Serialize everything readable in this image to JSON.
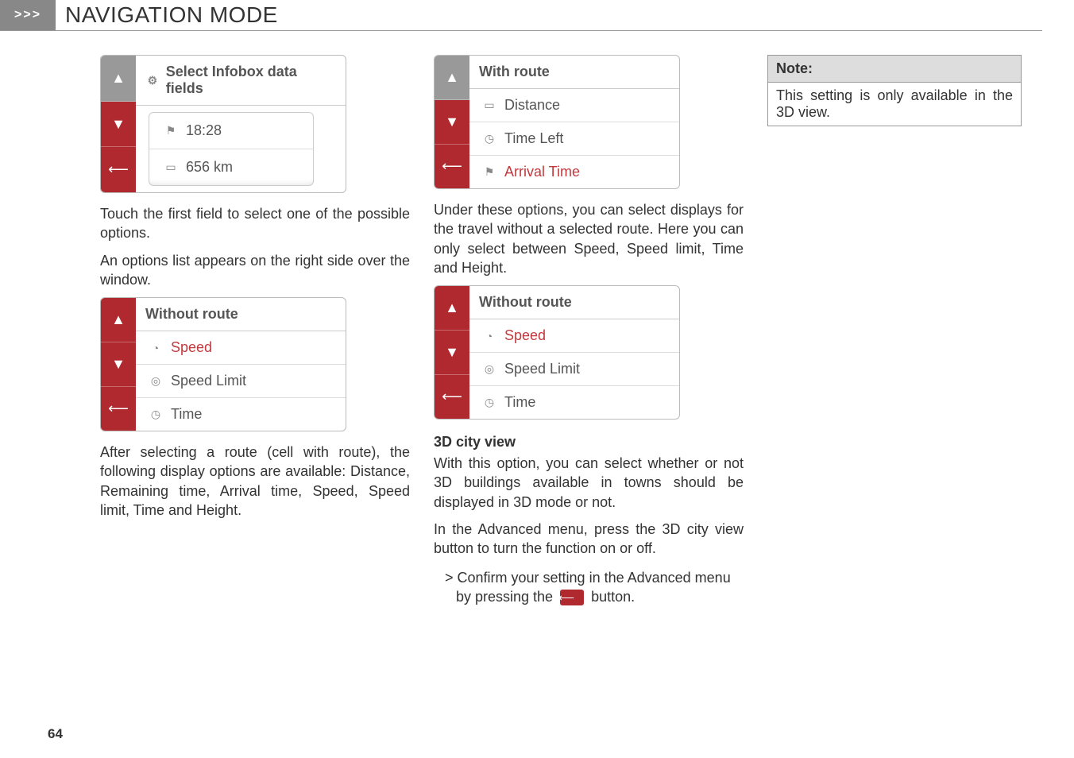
{
  "header": {
    "marker": ">>>",
    "title": "NAVIGATION MODE"
  },
  "col_left": {
    "widget1": {
      "title": "Select Infobox data fields",
      "row1": "18:28",
      "row2": "656 km"
    },
    "p1": "Touch the first field to select one of the possible options.",
    "p2": "An options list appears on the right side over the window.",
    "widget2": {
      "title": "Without route",
      "row1": "Speed",
      "row2": "Speed Limit",
      "row3": "Time"
    },
    "p3": "After selecting a route (cell with route), the following display options are available: Distance, Remaining time, Arrival time, Speed, Speed limit, Time and Height."
  },
  "col_mid": {
    "widget1": {
      "title": "With route",
      "row1": "Distance",
      "row2": "Time Left",
      "row3": "Arrival Time"
    },
    "p1": "Under these options, you can select displays for the travel without a selected route. Here you can only select between Speed, Speed limit, Time and Height.",
    "widget2": {
      "title": "Without route",
      "row1": "Speed",
      "row2": "Speed Limit",
      "row3": "Time"
    },
    "h1": "3D city view",
    "p2": "With this option, you can select whether or not 3D buildings available in towns should be displayed in 3D mode or not.",
    "p3": "In the Advanced menu, press the 3D city view button to turn the function on or off.",
    "bullet_a": "> Confirm your setting in the Advanced menu by pressing the ",
    "bullet_b": " button."
  },
  "col_right": {
    "note_title": "Note:",
    "note_body": "This setting is only available in the 3D view."
  },
  "page_number": "64"
}
